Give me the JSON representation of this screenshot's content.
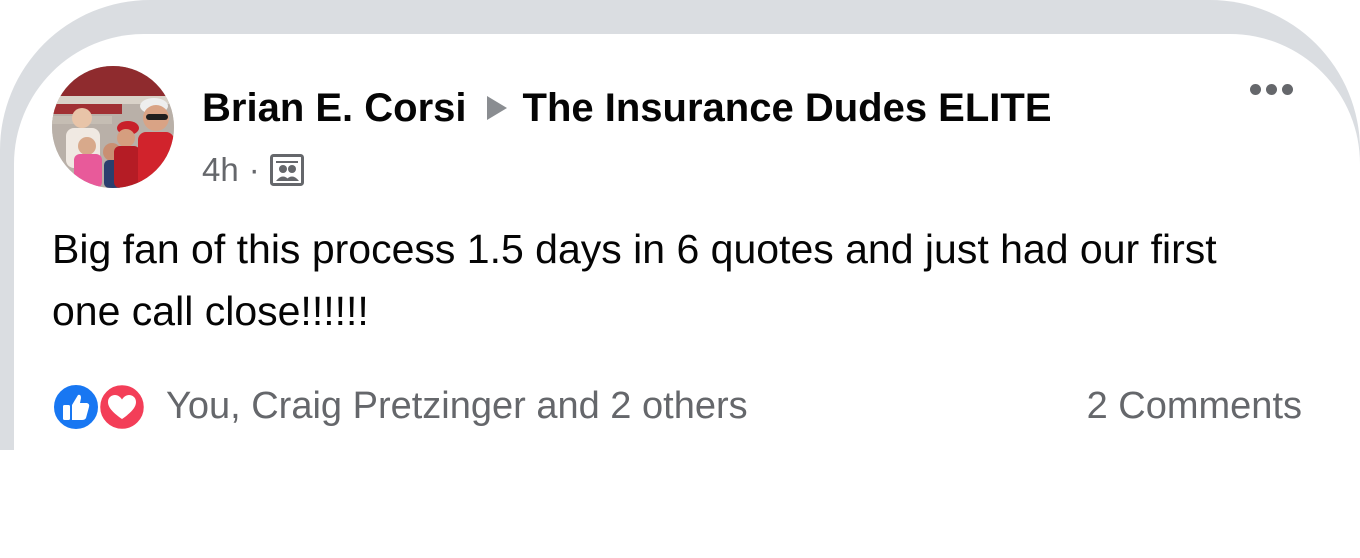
{
  "post": {
    "author": "Brian E. Corsi",
    "group": "The Insurance Dudes ELITE",
    "timestamp": "4h",
    "separator": "·",
    "audience_icon": "group-members-icon",
    "text": "Big fan of this process 1.5 days in 6 quotes and just had our first one call close!!!!!!"
  },
  "reactions": {
    "icons": [
      "like-icon",
      "love-icon"
    ],
    "text": "You, Craig Pretzinger and 2 others"
  },
  "comments": {
    "count_label": "2 Comments"
  },
  "colors": {
    "like_blue": "#1877f2",
    "love_red": "#f33e58",
    "secondary_text": "#65676b",
    "frame_gray": "#dadde1"
  }
}
